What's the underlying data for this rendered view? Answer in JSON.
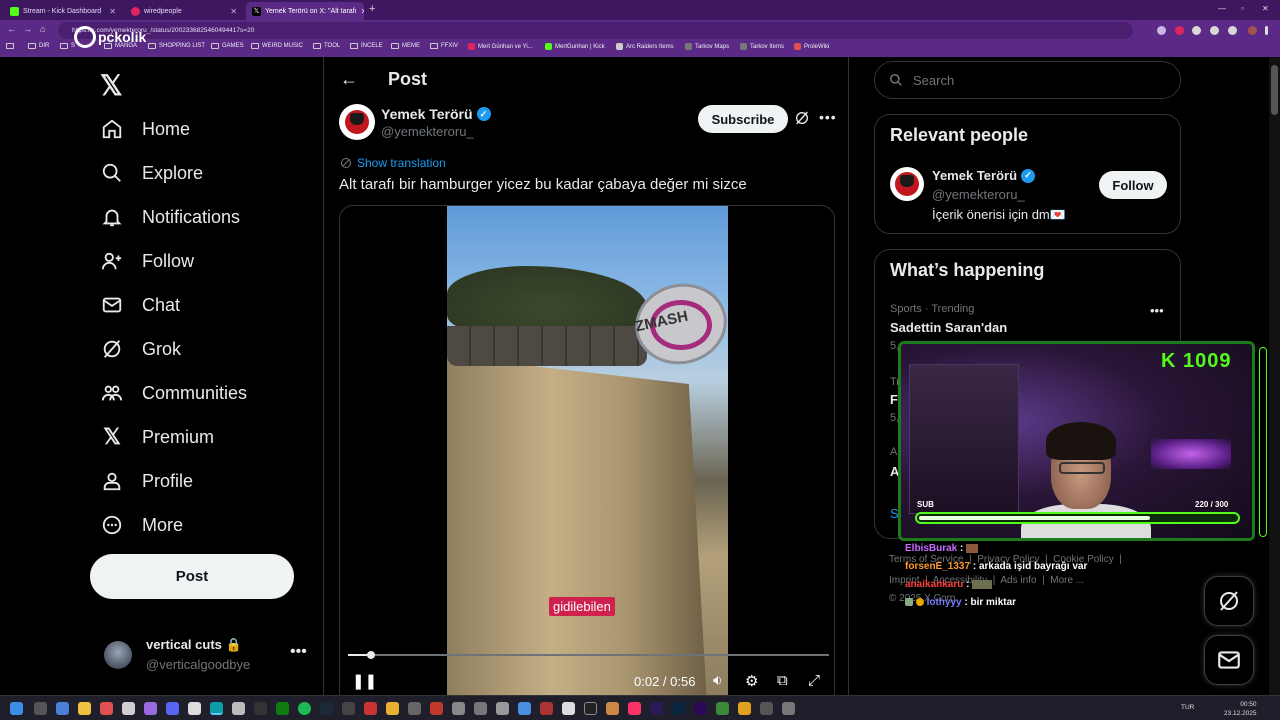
{
  "browser": {
    "tabs": [
      {
        "title": "Stream - Kick Dashboard",
        "color": "#53fc18",
        "active": false
      },
      {
        "title": "wiredpeople",
        "color": "#e0245e",
        "active": false
      },
      {
        "title": "Yemek Terörü on X: \"Alt tarafı",
        "color": "#000000",
        "active": true
      }
    ],
    "url": "https://x.com/yemekteroru_/status/2002336825460494417s=20",
    "bookmarks": [
      "DIR",
      "S",
      "MANGA",
      "SHOPPING LIST",
      "GAMES",
      "WEIRD MUSIC",
      "TOOL",
      "İNCELE",
      "MEME",
      "FFXIV",
      "Mert Günhan ve Yi...",
      "MertGunhan | Kick",
      "Arc Raiders Items",
      "Tarkov Maps",
      "Tarkov Items",
      "ProleWiki"
    ],
    "overlay_logo": "pckolik"
  },
  "sidebar": {
    "items": [
      {
        "label": "Home",
        "icon": "home-icon"
      },
      {
        "label": "Explore",
        "icon": "search-icon"
      },
      {
        "label": "Notifications",
        "icon": "bell-icon"
      },
      {
        "label": "Follow",
        "icon": "person-add-icon"
      },
      {
        "label": "Chat",
        "icon": "mail-icon"
      },
      {
        "label": "Grok",
        "icon": "grok-icon"
      },
      {
        "label": "Communities",
        "icon": "people-icon"
      },
      {
        "label": "Premium",
        "icon": "x-logo-icon"
      },
      {
        "label": "Profile",
        "icon": "person-icon"
      },
      {
        "label": "More",
        "icon": "more-circle-icon"
      }
    ],
    "post_button": "Post",
    "account": {
      "name": "vertical cuts",
      "handle": "@verticalgoodbye"
    }
  },
  "post": {
    "header": "Post",
    "author_name": "Yemek Terörü",
    "author_handle": "@yemekteroru_",
    "subscribe": "Subscribe",
    "show_translation": "Show translation",
    "text": "Alt tarafı bir hamburger yicez bu kadar çabaya değer mi sizce",
    "video": {
      "sign_text": "ZMASH",
      "caption": "gidilebilen",
      "time": "0:02 / 0:56",
      "progress": 0.04
    }
  },
  "right": {
    "search_placeholder": "Search",
    "relevant": {
      "title": "Relevant people",
      "name": "Yemek Terörü",
      "handle": "@yemekteroru_",
      "bio": "İçerik önerisi için dm💌",
      "follow": "Follow"
    },
    "happening": {
      "title": "What’s happening",
      "trend_category": "Sports · Trending",
      "trend_name": "Sadettin Saran'dan",
      "partial": [
        "5,",
        "Tr",
        "F",
        "5,",
        "A",
        "A",
        "S"
      ]
    },
    "footer": [
      "Terms of Service",
      "Privacy Policy",
      "Cookie Policy",
      "Imprint",
      "Accessibility",
      "Ads info",
      "More ...",
      "© 2025 X Corp."
    ]
  },
  "stream_overlay": {
    "kick_count": "K 1009",
    "sub_label": "SUB",
    "sub_count": "220 / 300",
    "sub_progress": 0.733,
    "chat": [
      {
        "user": "ElbisBurak",
        "user_color": "#c86bff",
        "message": ""
      },
      {
        "user": "forsenE_1337",
        "user_color": "#ff9b2f",
        "message": "arkada işid bayrağı var"
      },
      {
        "user": "anaikankaru",
        "user_color": "#ff4040",
        "message": ""
      },
      {
        "user": "lothyyy",
        "user_color": "#7c7cff",
        "message": "bir miktar"
      }
    ]
  },
  "taskbar": {
    "lang": "TUR",
    "time": "00:50",
    "date": "23.12.2025"
  }
}
